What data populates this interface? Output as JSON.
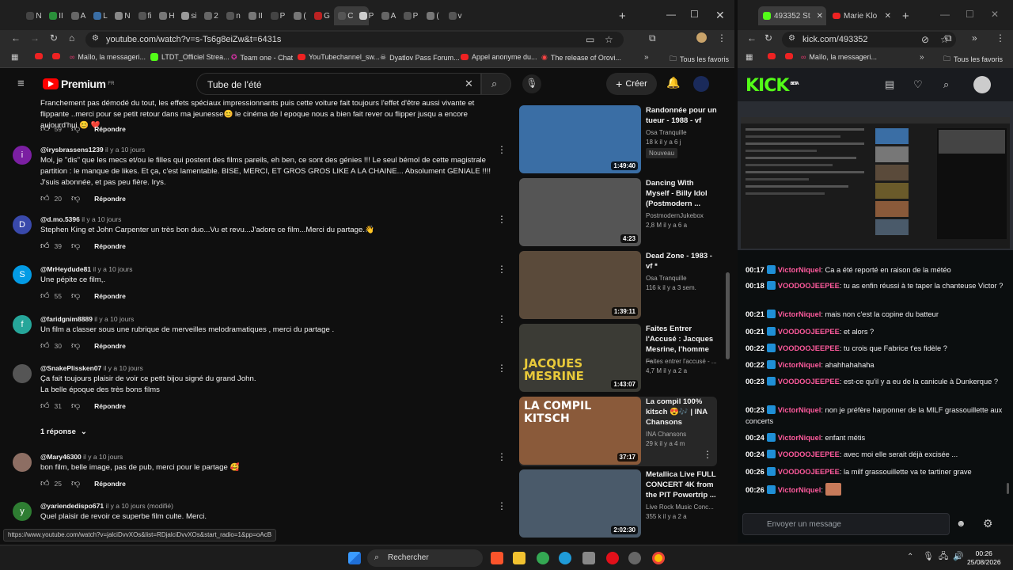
{
  "left_browser": {
    "tabs": [
      "N",
      "II",
      "A",
      "L",
      "N",
      "fi",
      "H",
      "si",
      "2",
      "n",
      "II",
      "P",
      "(",
      "G",
      "C",
      "P",
      "A",
      "P",
      "(",
      "v"
    ],
    "url": "youtube.com/watch?v=s-Ts6g8eiZw&t=6431s",
    "bookmarks": [
      "Maïlo, la messageri...",
      "LTDT_Officiel Strea...",
      "Team one - Chat",
      "YouTubechannel_sw...",
      "Dyatlov Pass Forum...",
      "Appel anonyme du...",
      "The release of Orovi...",
      "Tous les favoris"
    ],
    "status_url": "https://www.youtube.com/watch?v=jalciDvvXOs&list=RDjalciDvvXOs&start_radio=1&pp=oAcB"
  },
  "youtube": {
    "logo_text": "Premium",
    "logo_region": "FR",
    "search_query": "Tube de l'été",
    "create_label": "Créer",
    "comments": [
      {
        "text": "Franchement pas démodé du tout, les effets spéciaux impressionnants puis cette voiture fait  toujours  l'effet d'être aussi vivante et flippante ..merci  pour se petit retour dans ma jeunesse😊  le cinéma de l epoque  nous a  bien fait rever  ou flipper jusqu a encore aujourd'hui 😊 ❤️",
        "likes": "59",
        "reply": "Répondre"
      },
      {
        "user": "@irysbrassens1239",
        "time": "il y a 10 jours",
        "avatar": "i",
        "color": "#7b1fa2",
        "text": "Moi, je \"dis\" que les mecs et/ou le filles qui postent des films pareils, eh ben, ce sont des génies !!! Le seul bémol de cette magistrale partition : le manque de likes. Et ça, c'est lamentable. BISE, MERCI, ET GROS GROS LIKE A LA CHAINE... Absolument GENIALE !!!! J'suis abonnée, et pas peu fière. Irys.",
        "likes": "20",
        "reply": "Répondre"
      },
      {
        "user": "@d.mo.5396",
        "time": "il y a 10 jours",
        "avatar": "D",
        "color": "#3949ab",
        "text": "Stephen King et John Carpenter un très bon duo...Vu et revu...J'adore ce film...Merci du partage.👋",
        "likes": "39",
        "reply": "Répondre"
      },
      {
        "user": "@MrHeydude81",
        "time": "il y a 10 jours",
        "avatar": "S",
        "color": "#039be5",
        "text": "Une pépite ce film,.",
        "likes": "55",
        "reply": "Répondre"
      },
      {
        "user": "@faridgnim8889",
        "time": "il y a 10 jours",
        "avatar": "f",
        "color": "#26a69a",
        "text": "Un film a classer sous une rubrique de merveilles melodramatiques , merci  du partage .",
        "likes": "30",
        "reply": "Répondre"
      },
      {
        "user": "@SnakePlissken07",
        "time": "il y a 10 jours",
        "avatar": "",
        "color": "#555555",
        "text": "Ça fait toujours plaisir de voir ce petit bijou signé du grand John.\nLa belle époque des très bons films",
        "likes": "31",
        "reply": "Répondre",
        "replies_label": "1 réponse"
      },
      {
        "user": "@Mary46300",
        "time": "il y a 10 jours",
        "avatar": "",
        "color": "#8d6e63",
        "text": "bon film, belle image, pas de pub, merci pour le partage 🥰",
        "likes": "25",
        "reply": "Répondre"
      },
      {
        "user": "@yariendedispo671",
        "time": "il y a 10 jours (modifié)",
        "avatar": "y",
        "color": "#2e7d32",
        "text": "Quel plaisir de revoir ce superbe film culte. Merci."
      }
    ],
    "sidebar_videos": [
      {
        "title": "Randonnée pour un tueur - 1988 - vf",
        "channel": "Osa Tranquille",
        "stats": "18 k  il y a 6 j",
        "badge": "Nouveau",
        "duration": "1:49:40",
        "bg": "#3a6ea5"
      },
      {
        "title": "Dancing With Myself - Billy Idol (Postmodern ...",
        "channel": "PostmodernJukebox",
        "stats": "2,8 M  il y a 6 a",
        "duration": "4:23",
        "bg": "#555555"
      },
      {
        "title": "Dead Zone - 1983  - vf *",
        "channel": "Osa Tranquille",
        "stats": "116 k  il y a 3 sem.",
        "duration": "1:39:11",
        "bg": "#5a4a3a"
      },
      {
        "title": "Faites Entrer l'Accusé : Jacques Mesrine, l'homme ...",
        "channel": "Faites entrer l'accusé - ...",
        "stats": "4,7 M  il y a 2 a",
        "duration": "1:43:07",
        "bg": "#3b3b35",
        "thumb_text": "JACQUES MESRINE"
      },
      {
        "title": "La compil 100% kitsch 😍🎶 | INA Chansons",
        "channel": "INA Chansons",
        "stats": "29 k  il y a 4 m",
        "duration": "37:17",
        "bg": "#8a5a3a",
        "thumb_text": "LA COMPIL KITSCH"
      },
      {
        "title": "Metallica Live FULL CONCERT 4K from the PIT Powertrip ...",
        "channel": "Live Rock Music Conc...",
        "stats": "355 k  il y a 2 a",
        "duration": "2:02:30",
        "bg": "#4a5a6a"
      }
    ]
  },
  "right_browser": {
    "tabs": [
      "493352 St",
      "Marie Klo"
    ],
    "url": "kick.com/493352",
    "bookmarks": [
      "Maïlo, la messageri...",
      "Tous les favoris"
    ]
  },
  "kick": {
    "logo": "KICK",
    "logo_badge": "BETA",
    "chat": [
      {
        "time": "00:17",
        "user": "VictorNiquel",
        "msg": "Ca a été reporté en raison de la météo"
      },
      {
        "time": "00:18",
        "user": "VOODOOJEEPEE",
        "msg": "tu as enfin réussi à te taper la chanteuse Victor ?"
      },
      {
        "time": "00:21",
        "user": "VictorNiquel",
        "msg": "mais non c'est la copine du batteur"
      },
      {
        "time": "00:21",
        "user": "VOODOOJEEPEE",
        "msg": "et alors ?"
      },
      {
        "time": "00:22",
        "user": "VOODOOJEEPEE",
        "msg": "tu crois que Fabrice t'es fidèle ?"
      },
      {
        "time": "00:22",
        "user": "VictorNiquel",
        "msg": "ahahhahahaha"
      },
      {
        "time": "00:23",
        "user": "VOODOOJEEPEE",
        "msg": "est-ce qu'il y a eu de la canicule à Dunkerque ?"
      },
      {
        "time": "00:23",
        "user": "VictorNiquel",
        "msg": "non je préfère harponner de la MILF grassouillette aux concerts"
      },
      {
        "time": "00:24",
        "user": "VictorNiquel",
        "msg": "enfant métis"
      },
      {
        "time": "00:24",
        "user": "VOODOOJEEPEE",
        "msg": "avec moi elle serait déjà excisée ..."
      },
      {
        "time": "00:26",
        "user": "VOODOOJEEPEE",
        "msg": "la milf grassouillette va te tartiner grave"
      },
      {
        "time": "00:26",
        "user": "VictorNiquel",
        "msg": ""
      }
    ],
    "chat_placeholder": "Envoyer un message"
  },
  "taskbar": {
    "search_label": "Rechercher",
    "time": "00:26",
    "date": "25/08/2026"
  },
  "colors": {
    "yt_red": "#ff0000",
    "kick_green": "#53fc18",
    "chat_user": "#ff5a9d"
  }
}
